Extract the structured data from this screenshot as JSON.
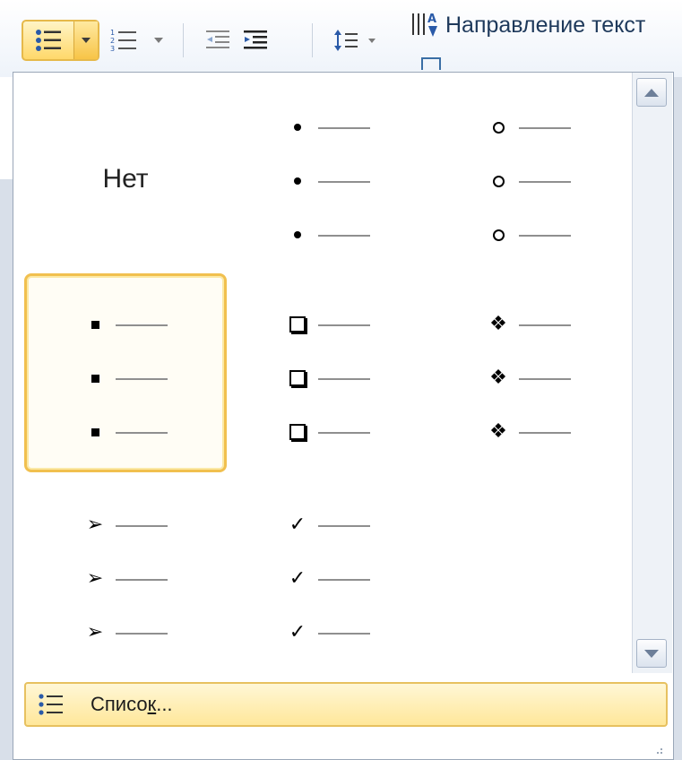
{
  "ribbon": {
    "text_direction_label": "Направление текст"
  },
  "gallery": {
    "none_label": "Нет",
    "items": [
      {
        "name": "none",
        "symbol": ""
      },
      {
        "name": "filled-dot",
        "symbol": "•"
      },
      {
        "name": "hollow-circle",
        "symbol": "○"
      },
      {
        "name": "filled-square",
        "symbol": "■"
      },
      {
        "name": "hollow-box",
        "symbol": "❑"
      },
      {
        "name": "four-diamond",
        "symbol": "❖"
      },
      {
        "name": "arrowhead",
        "symbol": "➢"
      },
      {
        "name": "checkmark",
        "symbol": "✓"
      }
    ],
    "selected_item": "filled-square"
  },
  "footer": {
    "label_before": "Списо",
    "label_underlined": "к",
    "label_after": "..."
  },
  "colors": {
    "accent_border": "#f1c04f",
    "highlight_fill": "#ffe79a",
    "ribbon_text": "#1e395b"
  }
}
